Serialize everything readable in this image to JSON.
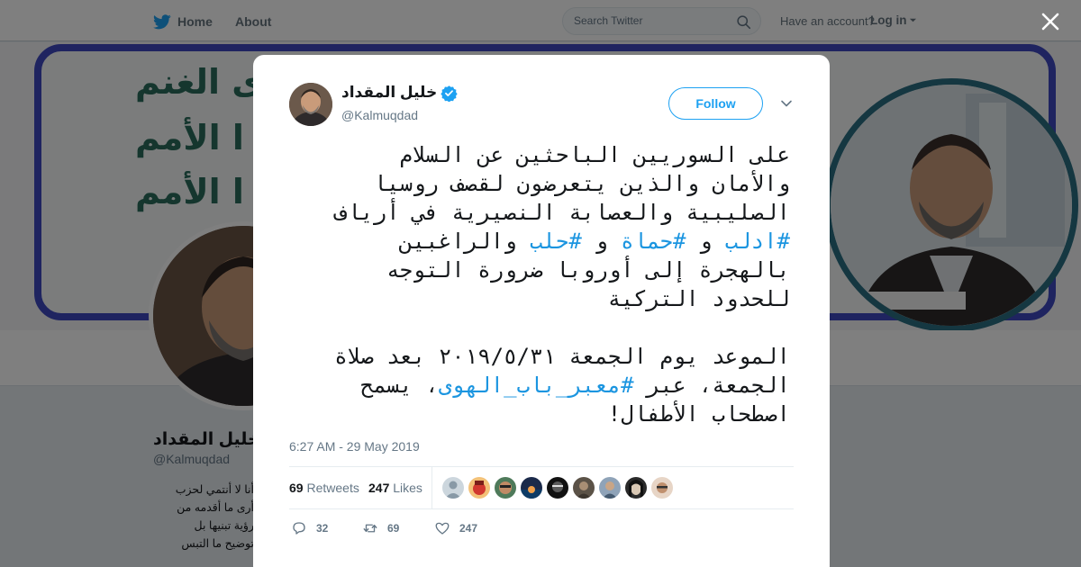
{
  "topbar": {
    "home_label": "Home",
    "about_label": "About",
    "search_placeholder": "Search Twitter",
    "account_prompt": "Have an account?",
    "login_label": "Log in"
  },
  "profile": {
    "name": "خليل المقداد",
    "handle": "@Kalmuqdad",
    "bio": "أنا لا أنتمي لحزب\nأرى ما أقدمه من\nرؤية تبنيها بل\nتوضيح ما التبس"
  },
  "tweet": {
    "author_name": "خليل المقداد",
    "author_handle": "@Kalmuqdad",
    "follow_label": "Follow",
    "lines": [
      "على السوريين الباحثين عن السلام",
      "والأمان والذين يتعرضون لقصف روسيا",
      "الصليبية والعصابة النصيرية في أرياف",
      "",
      "بالهجرة إلى أوروبا ضرورة التوجه",
      "للحدود التركية",
      "",
      "الموعد يوم الجمعة ٢٠١٩/٥/٣١ بعد صلاة",
      "",
      "اصطحاب الأطفال!"
    ],
    "line4": {
      "tag1": "#ادلب",
      "and1": " و ",
      "tag2": "#حماة",
      "and2": " و ",
      "tag3": "#حلب",
      "rest": " والراغبين"
    },
    "line8": {
      "pre": "الجمعة، عبر ",
      "tag": "#معبر_باب_الهوى",
      "post": "، يسمح"
    },
    "timestamp": "6:27 AM - 29 May 2019",
    "retweets_count": "69",
    "retweets_label": "Retweets",
    "likes_count": "247",
    "likes_label": "Likes",
    "reply_count": "32",
    "retweet_count": "69",
    "like_count": "247"
  },
  "colors": {
    "link": "#1b95e0",
    "follow": "#1da1f2",
    "muted": "#657786"
  },
  "icons": [
    "twitter-bird-icon",
    "search-icon",
    "caret-down-icon",
    "close-icon",
    "verified-badge-icon",
    "chevron-down-icon",
    "reply-icon",
    "retweet-icon",
    "heart-icon"
  ]
}
